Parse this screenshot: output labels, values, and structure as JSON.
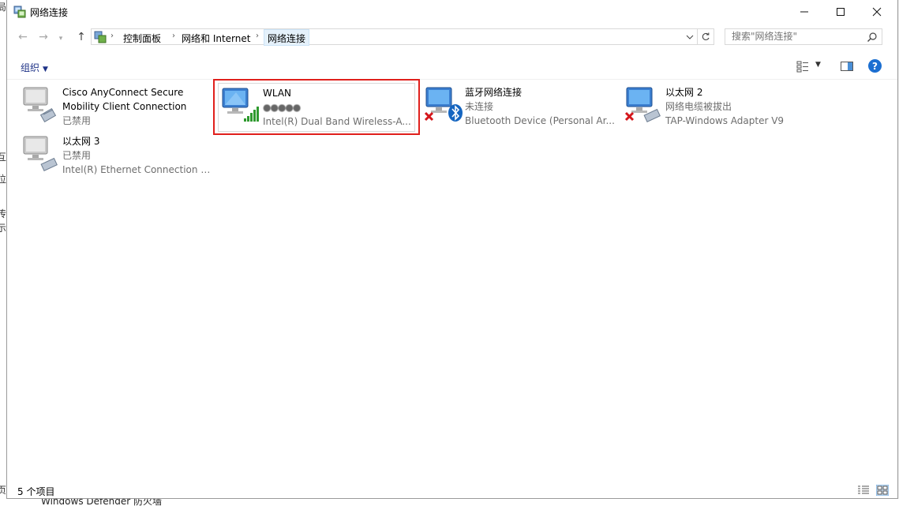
{
  "window": {
    "title": "网络连接"
  },
  "nav": {
    "breadcrumb": [
      "控制面板",
      "网络和 Internet",
      "网络连接"
    ],
    "search_placeholder": "搜索\"网络连接\""
  },
  "toolbar": {
    "organize_label": "组织"
  },
  "connections": [
    {
      "name": "Cisco AnyConnect Secure",
      "name_line2": "Mobility Client Connection",
      "status": "已禁用",
      "device": ""
    },
    {
      "name": "WLAN",
      "status": "",
      "device": "Intel(R) Dual Band Wireless-A..."
    },
    {
      "name": "蓝牙网络连接",
      "status": "未连接",
      "device": "Bluetooth Device (Personal Ar..."
    },
    {
      "name": "以太网 2",
      "status": "网络电缆被拔出",
      "device": "TAP-Windows Adapter V9"
    },
    {
      "name": "以太网 3",
      "status": "已禁用",
      "device": "Intel(R) Ethernet Connection I2..."
    }
  ],
  "status_bar": {
    "item_count": "5 个项目"
  },
  "background": {
    "bottom_text": "Windows Defender 防火墙"
  },
  "colors": {
    "accent": "#1c6fd1",
    "highlight": "#e0201c",
    "organize": "#1e3287"
  }
}
